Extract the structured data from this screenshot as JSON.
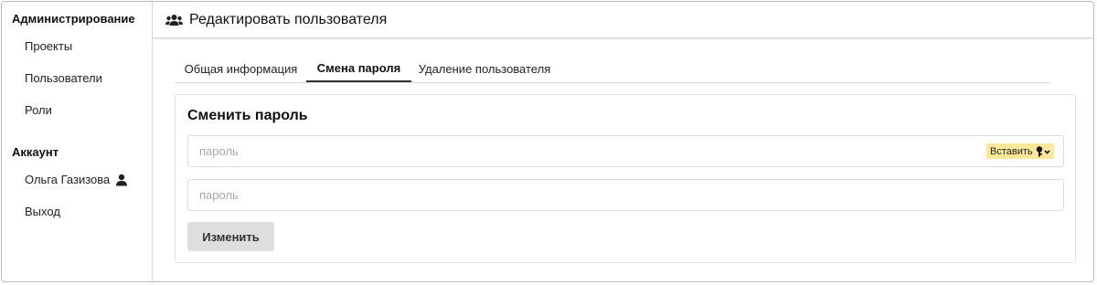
{
  "sidebar": {
    "admin_title": "Администрирование",
    "admin_items": [
      {
        "label": "Проекты"
      },
      {
        "label": "Пользователи"
      },
      {
        "label": "Роли"
      }
    ],
    "account_title": "Аккаунт",
    "account_user": "Ольга Газизова",
    "logout_label": "Выход"
  },
  "header": {
    "icon": "users-icon",
    "title": "Редактировать пользователя"
  },
  "tabs": [
    {
      "label": "Общая информация",
      "active": false
    },
    {
      "label": "Смена пароля",
      "active": true
    },
    {
      "label": "Удаление пользователя",
      "active": false
    }
  ],
  "form": {
    "title": "Сменить пароль",
    "password_placeholder": "пароль",
    "confirm_placeholder": "пароль",
    "paste_label": "Вставить",
    "paste_icon": "key-icon",
    "submit_label": "Изменить"
  },
  "colors": {
    "paste_badge_bg": "#fbe89a",
    "button_bg": "#dedede",
    "active_tab_border": "#333333"
  }
}
